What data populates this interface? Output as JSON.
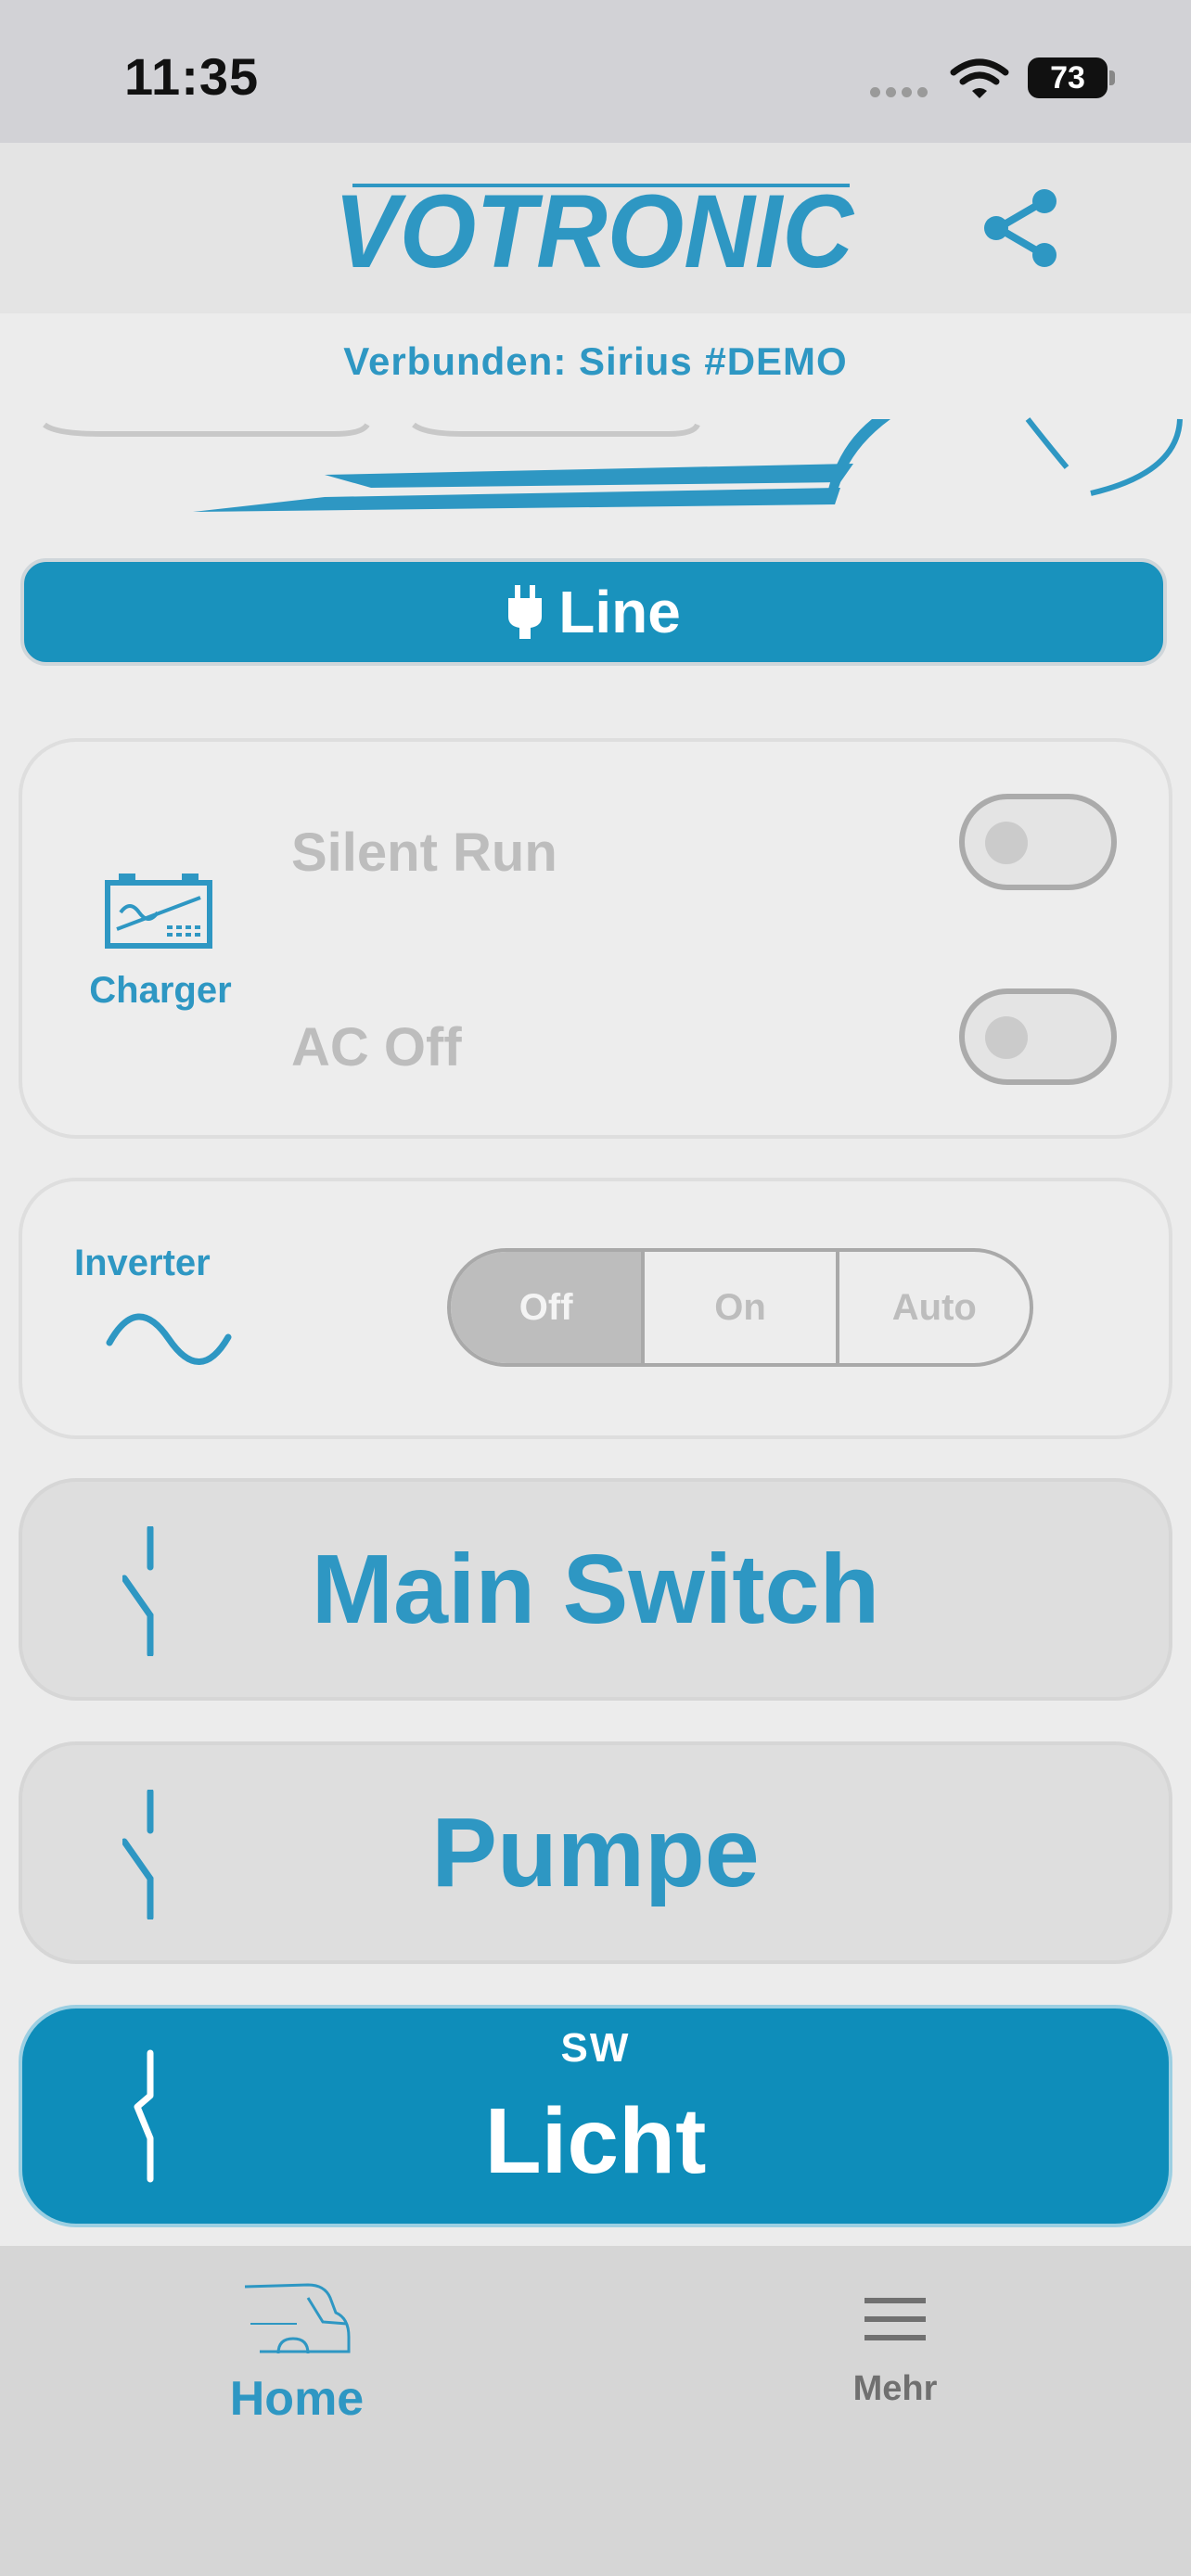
{
  "status_bar": {
    "time": "11:35",
    "battery": "73"
  },
  "header": {
    "logo": "VOTRONIC",
    "share_icon": "share-icon"
  },
  "connection": {
    "text": "Verbunden: Sirius #DEMO"
  },
  "line_button": {
    "label": "Line",
    "icon": "plug-icon"
  },
  "charger": {
    "label": "Charger",
    "icon": "battery-charger-icon",
    "silent_run": {
      "label": "Silent Run",
      "on": false
    },
    "ac_off": {
      "label": "AC Off",
      "on": false
    }
  },
  "inverter": {
    "label": "Inverter",
    "icon": "sine-wave-icon",
    "options": [
      "Off",
      "On",
      "Auto"
    ],
    "selected": "Off"
  },
  "switches": [
    {
      "label": "Main Switch",
      "sublabel": "",
      "active": false
    },
    {
      "label": "Pumpe",
      "sublabel": "",
      "active": false
    },
    {
      "label": "Licht",
      "sublabel": "SW",
      "active": true
    }
  ],
  "tab_bar": {
    "home": {
      "label": "Home",
      "icon": "camper-van-icon",
      "selected": true
    },
    "more": {
      "label": "Mehr",
      "icon": "menu-icon",
      "selected": false
    }
  },
  "colors": {
    "accent": "#2e97c3",
    "active_fill": "#0e8dba",
    "line_fill": "#1992bd"
  }
}
